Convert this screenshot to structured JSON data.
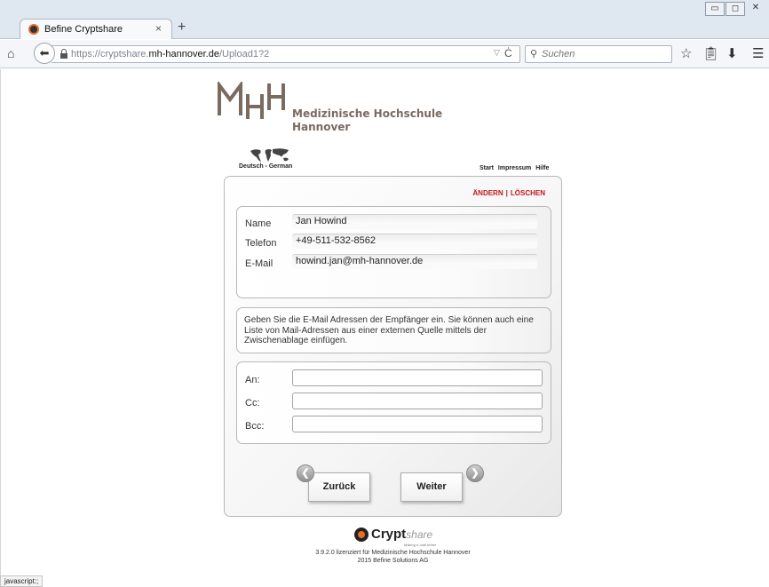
{
  "browser": {
    "tab_title": "Befine Cryptshare",
    "tab_close": "×",
    "new_tab": "+",
    "url_prefix": "https://cryptshare.",
    "url_domain": "mh-hannover.de",
    "url_path": "/Upload1?2",
    "search_placeholder": "Suchen",
    "status_text": "javascript:;"
  },
  "header": {
    "logo_mark": "MHH",
    "institution_line1": "Medizinische Hochschule",
    "institution_line2": "Hannover",
    "language_link": "Deutsch - German",
    "links": [
      "Start",
      "Impressum",
      "Hilfe"
    ]
  },
  "panel": {
    "edit_label": "ÄNDERN",
    "separator": "|",
    "delete_label": "LÖSCHEN",
    "sender": {
      "name_label": "Name",
      "name_value": "Jan Howind",
      "phone_label": "Telefon",
      "phone_value": "+49-511-532-8562",
      "email_label": "E-Mail",
      "email_value": "howind.jan@mh-hannover.de"
    },
    "info_text": "Geben Sie die E-Mail Adressen der Empfänger ein. Sie können auch eine Liste von Mail-Adressen aus einer externen Quelle mittels der Zwischenablage einfügen.",
    "recipients": {
      "to_label": "An:",
      "cc_label": "Cc:",
      "bcc_label": "Bcc:"
    },
    "back_button": "Zurück",
    "next_button": "Weiter"
  },
  "footer": {
    "brand_bold": "Crypt",
    "brand_italic": "share",
    "tagline": "Making e-mail better",
    "license_line": "3.9.2.0 lizenziert für Medizinische Hochschule Hannover",
    "copyright_line": "2015 Befine Solutions AG"
  },
  "colors": {
    "accent_red": "#c4161c",
    "logo_brown": "#7a6a60",
    "cryptshare_orange": "#e96b2c"
  }
}
